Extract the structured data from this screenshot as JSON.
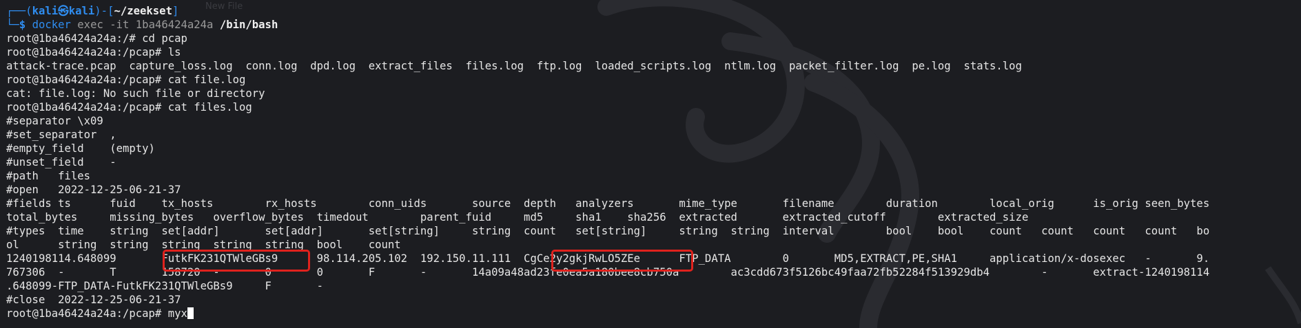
{
  "theme": {
    "prompt_color": "#2f8df0",
    "text_color": "#e6e6e6",
    "highlight_color": "#e0221d",
    "background": "#1c1d21"
  },
  "prompt_header": {
    "user": "kali",
    "at_symbol": "㉿",
    "host": "kali",
    "path": "~/zeekset",
    "command": "docker",
    "args": "exec -it 1ba46424a24a",
    "shell": "/bin/bash"
  },
  "lines": [
    "root@1ba46424a24a:/# cd pcap",
    "root@1ba46424a24a:/pcap# ls",
    "attack-trace.pcap  capture_loss.log  conn.log  dpd.log  extract_files  files.log  ftp.log  loaded_scripts.log  ntlm.log  packet_filter.log  pe.log  stats.log",
    "root@1ba46424a24a:/pcap# cat file.log",
    "cat: file.log: No such file or directory",
    "root@1ba46424a24a:/pcap# cat files.log",
    "#separator \\x09",
    "#set_separator  ,",
    "#empty_field    (empty)",
    "#unset_field    -",
    "#path   files",
    "#open   2022-12-25-06-21-37",
    "#fields ts      fuid    tx_hosts        rx_hosts        conn_uids       source  depth   analyzers       mime_type       filename        duration        local_orig      is_orig seen_bytes",
    "total_bytes     missing_bytes   overflow_bytes  timedout        parent_fuid     md5     sha1    sha256  extracted       extracted_cutoff        extracted_size",
    "#types  time    string  set[addr]       set[addr]       set[string]     string  count   set[string]     string  string  interval        bool    bool    count   count   count   count   bo",
    "ol      string  string  string  string  string  bool    count",
    "1240198114.648099       FutkFK231QTWleGBs9      98.114.205.102  192.150.11.111  CgCe2y2gkjRwLO5ZEe      FTP_DATA        0       MD5,EXTRACT,PE,SHA1     application/x-dosexec   -       9.",
    "767306  -       T       158720  -       0       0       F       -       14a09a48ad23fe0ea5a180bee8cb750a        ac3cdd673f5126bc49faa72fb52284f513929db4        -       extract-1240198114",
    ".648099-FTP_DATA-FutkFK231QTWleGBs9     F       -",
    "#close  2022-12-25-06-21-37",
    "root@1ba46424a24a:/pcap# myx"
  ],
  "highlights": [
    "FutkFK231QTWleGBs9",
    "CgCe2y2gkjRwLO5ZEe"
  ],
  "watermark_text": "New File"
}
